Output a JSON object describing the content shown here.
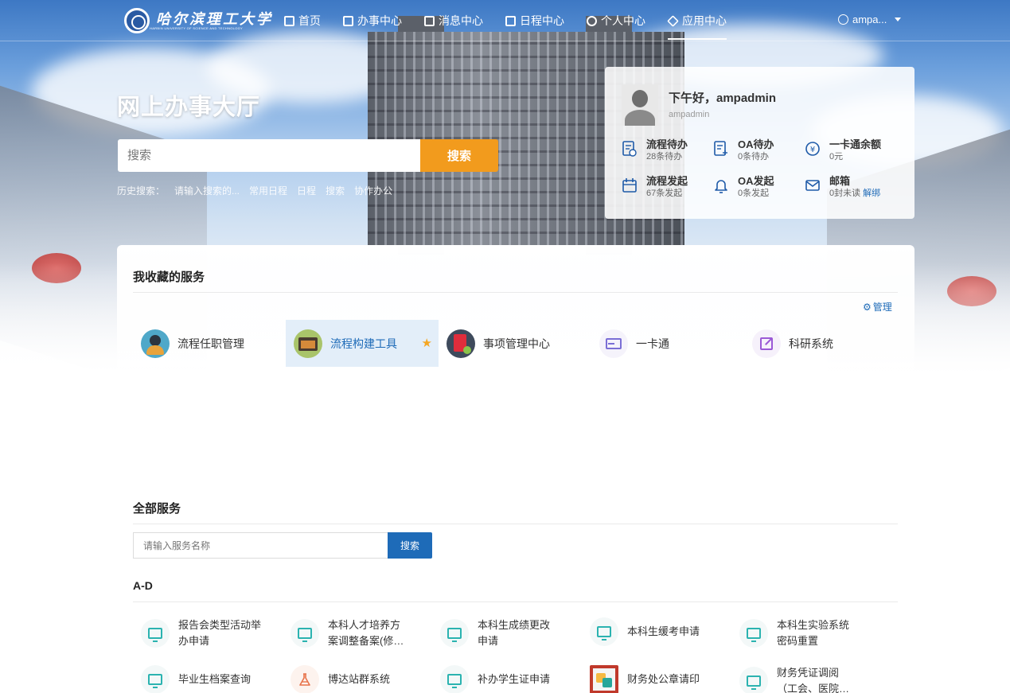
{
  "nav": {
    "logo_name": "哈尔滨理工大学",
    "logo_sub": "HARBIN UNIVERSITY OF SCIENCE AND TECHNOLOGY",
    "items": [
      {
        "label": "首页",
        "icon": "bank-icon"
      },
      {
        "label": "办事中心",
        "icon": "form-icon"
      },
      {
        "label": "消息中心",
        "icon": "message-icon"
      },
      {
        "label": "日程中心",
        "icon": "calendar-doc-icon"
      },
      {
        "label": "个人中心",
        "icon": "person-icon"
      },
      {
        "label": "应用中心",
        "icon": "layers-icon",
        "active": true
      }
    ],
    "user": "ampa..."
  },
  "hero": {
    "title": "网上办事大厅",
    "search_placeholder": "搜索",
    "search_button": "搜索",
    "history": [
      "历史搜索：",
      "请输入搜索的...",
      "常用日程",
      "日程",
      "搜索",
      "协作办公"
    ]
  },
  "user_card": {
    "greeting": "下午好，ampadmin",
    "username": "ampadmin",
    "stats": [
      {
        "title": "流程待办",
        "sub": "28条待办",
        "icon": "doc-clock-icon"
      },
      {
        "title": "OA待办",
        "sub": "0条待办",
        "icon": "doc-plus-icon"
      },
      {
        "title": "一卡通余额",
        "sub": "0元",
        "icon": "yuan-icon"
      },
      {
        "title": "流程发起",
        "sub": "67条发起",
        "icon": "calendar-icon"
      },
      {
        "title": "OA发起",
        "sub": "0条发起",
        "icon": "bell-icon"
      },
      {
        "title": "邮箱",
        "sub": "0封未读",
        "link": "解绑",
        "icon": "mail-icon"
      }
    ]
  },
  "favorites": {
    "title": "我收藏的服务",
    "manage": "管理",
    "items": [
      {
        "label": "流程任职管理",
        "icon": "person-review-icon",
        "color": "#4fa8c9"
      },
      {
        "label": "流程构建工具",
        "icon": "toolbox-icon",
        "color": "#a9c46a",
        "selected": true
      },
      {
        "label": "事项管理中心",
        "icon": "red-book-icon",
        "color": "#3e4a5c"
      },
      {
        "label": "一卡通",
        "icon": "card-icon",
        "color": "#7b6fd6"
      },
      {
        "label": "科研系统",
        "icon": "edit-icon",
        "color": "#9b59d6"
      }
    ]
  },
  "all_services": {
    "title": "全部服务",
    "search_placeholder": "请输入服务名称",
    "search_button": "搜索",
    "group": "A-D",
    "rows": [
      [
        {
          "label": "报告会类型活动举办申请",
          "icon": "monitor-icon"
        },
        {
          "label": "本科人才培养方案调整备案(修…",
          "icon": "monitor-icon"
        },
        {
          "label": "本科生成绩更改申请",
          "icon": "monitor-icon"
        },
        {
          "label": "本科生缓考申请",
          "icon": "monitor-icon"
        },
        {
          "label": "本科生实验系统密码重置",
          "icon": "monitor-icon"
        }
      ],
      [
        {
          "label": "毕业生档案查询",
          "icon": "monitor-icon"
        },
        {
          "label": "博达站群系统",
          "icon": "flask-icon"
        },
        {
          "label": "补办学生证申请",
          "icon": "monitor-icon"
        },
        {
          "label": "财务处公章请印",
          "icon": "finance-app-icon"
        },
        {
          "label": "财务凭证调阅（工会、医院…",
          "icon": "monitor-icon"
        }
      ]
    ]
  }
}
